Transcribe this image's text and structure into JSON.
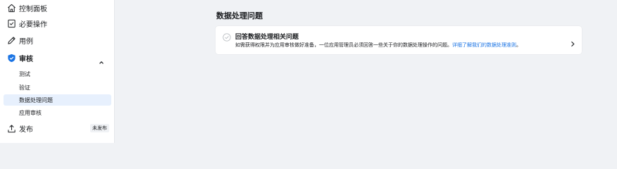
{
  "sidebar": {
    "items": [
      {
        "label": "控制面板",
        "icon": "home-icon"
      },
      {
        "label": "必要操作",
        "icon": "checklist-icon"
      },
      {
        "label": "用例",
        "icon": "pencil-icon"
      },
      {
        "label": "审核",
        "icon": "shield-check-icon"
      }
    ],
    "review_subitems": [
      {
        "label": "测试"
      },
      {
        "label": "验证"
      },
      {
        "label": "数据处理问题"
      },
      {
        "label": "应用审核"
      }
    ],
    "publish": {
      "label": "发布",
      "badge": "未发布",
      "icon": "upload-icon"
    }
  },
  "main": {
    "title": "数据处理问题",
    "card": {
      "title": "回答数据处理相关问题",
      "description": "如需获得权限并为应用审核做好准备，一位应用管理员必须回答一些关于你的数据处理操作的问题。",
      "link": "详细了解我们的数据处理准则",
      "trailing": "。"
    }
  },
  "colors": {
    "accent": "#1b74e4",
    "active_bg": "#e7f0fd",
    "page_bg": "#f0f2f5"
  }
}
